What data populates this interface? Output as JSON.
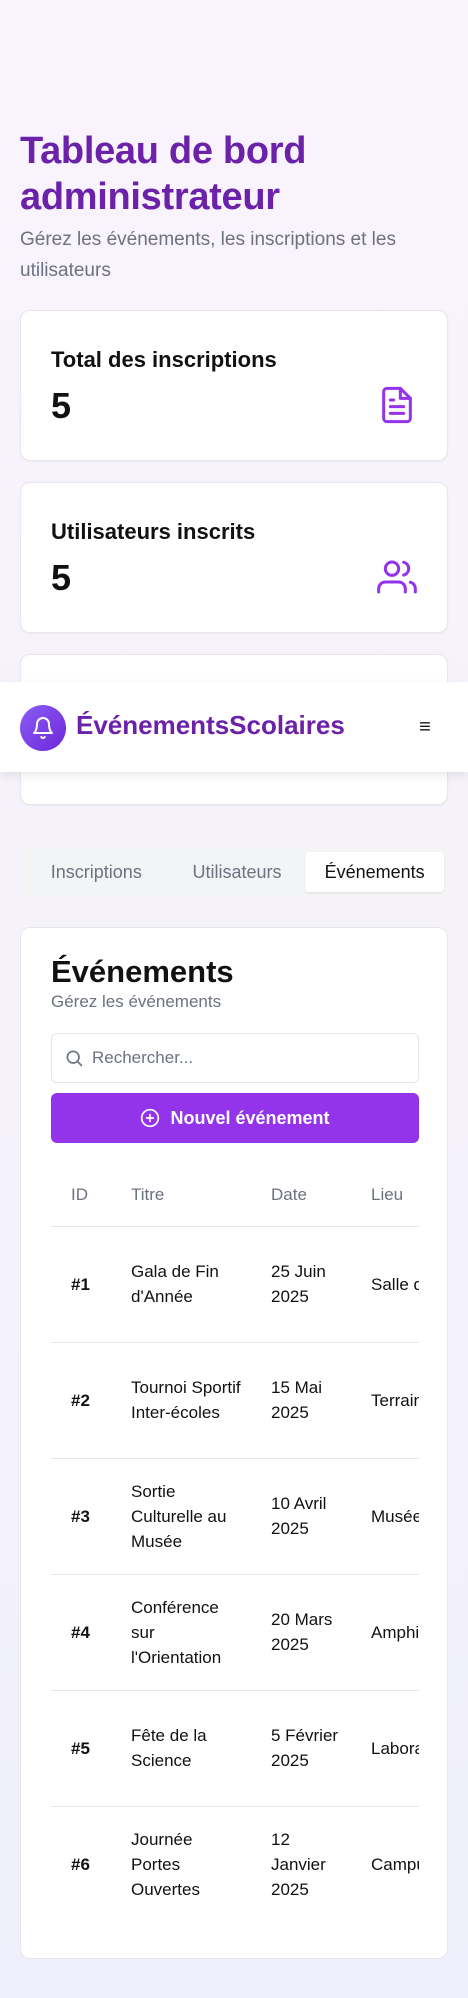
{
  "header": {
    "title": "Tableau de bord administrateur",
    "subtitle": "Gérez les événements, les inscriptions et les utilisateurs"
  },
  "stats": [
    {
      "label": "Total des inscriptions",
      "value": "5",
      "icon": "document-icon"
    },
    {
      "label": "Utilisateurs inscrits",
      "value": "5",
      "icon": "users-icon"
    }
  ],
  "navbar": {
    "brand": "ÉvénementsScolaires",
    "logo_icon": "bell-icon",
    "menu_icon": "hamburger-menu-icon",
    "menu_glyph": "≡"
  },
  "tabs": [
    {
      "label": "Inscriptions",
      "active": false
    },
    {
      "label": "Utilisateurs",
      "active": false
    },
    {
      "label": "Événements",
      "active": true
    }
  ],
  "events": {
    "title": "Événements",
    "description": "Gérez les événements",
    "search_placeholder": "Rechercher...",
    "new_button": "Nouvel événement",
    "columns": [
      "ID",
      "Titre",
      "Date",
      "Lieu"
    ],
    "rows": [
      {
        "id": "#1",
        "title": "Gala de Fin d'Année",
        "date": "25 Juin 2025",
        "lieu": "Salle des Fêtes du Lycée"
      },
      {
        "id": "#2",
        "title": "Tournoi Sportif Inter-écoles",
        "date": "15 Mai 2025",
        "lieu": "Terrain de sport"
      },
      {
        "id": "#3",
        "title": "Sortie Culturelle au Musée",
        "date": "10 Avril 2025",
        "lieu": "Musée National"
      },
      {
        "id": "#4",
        "title": "Conférence sur l'Orientation",
        "date": "20 Mars 2025",
        "lieu": "Amphithéâtre de l'école"
      },
      {
        "id": "#5",
        "title": "Fête de la Science",
        "date": "5 Février 2025",
        "lieu": "Laboratoire de l'école"
      },
      {
        "id": "#6",
        "title": "Journée Portes Ouvertes",
        "date": "12 Janvier 2025",
        "lieu": "Campus principal"
      }
    ]
  },
  "colors": {
    "accent": "#9333ea",
    "title_purple": "#6b21a8",
    "icon_purple": "#9333ea"
  }
}
